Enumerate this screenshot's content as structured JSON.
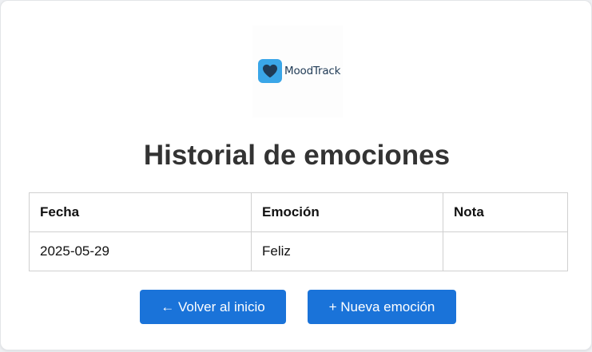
{
  "logo": {
    "brand_name": "MoodTrack",
    "icon": "heart-icon",
    "icon_bg": "#3aa6e8",
    "icon_fg": "#1f3a55"
  },
  "title": "Historial de emociones",
  "table": {
    "headers": [
      "Fecha",
      "Emoción",
      "Nota"
    ],
    "rows": [
      [
        "2025-05-29",
        "Feliz",
        ""
      ]
    ]
  },
  "buttons": {
    "back_label": "← Volver al inicio",
    "new_label": "+ Nueva emoción"
  },
  "colors": {
    "accent": "#1a73d9",
    "title": "#333333"
  }
}
